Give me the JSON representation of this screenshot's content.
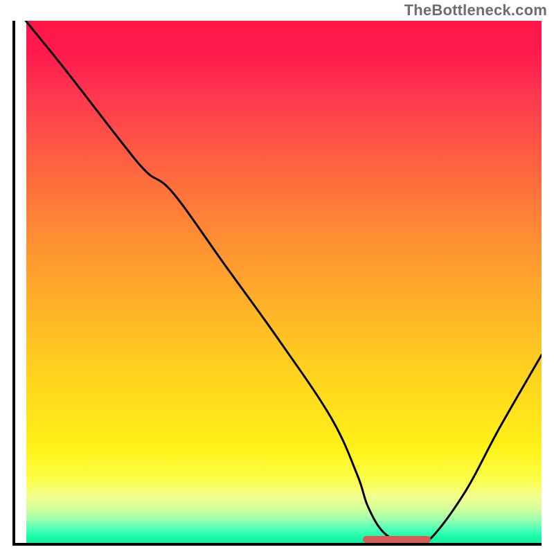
{
  "watermark": "TheBottleneck.com",
  "chart_data": {
    "type": "line",
    "title": "",
    "xlabel": "",
    "ylabel": "",
    "xlim": [
      0,
      100
    ],
    "ylim": [
      0,
      100
    ],
    "grid": false,
    "series": [
      {
        "name": "curve",
        "x": [
          2,
          10,
          20,
          25,
          30,
          40,
          50,
          60,
          65,
          67,
          70,
          74,
          78,
          85,
          92,
          100
        ],
        "y": [
          100,
          90,
          77,
          71,
          67,
          53,
          39,
          24,
          13,
          7,
          2,
          0,
          0,
          9,
          22,
          36
        ]
      }
    ],
    "annotations": [
      {
        "name": "optimum-marker",
        "x_start": 66,
        "x_end": 79,
        "y": 0,
        "color": "#d65b58"
      }
    ],
    "background_gradient": {
      "top": "#ff1748",
      "mid": "#ffd31e",
      "bottom": "#16f2a2"
    }
  }
}
